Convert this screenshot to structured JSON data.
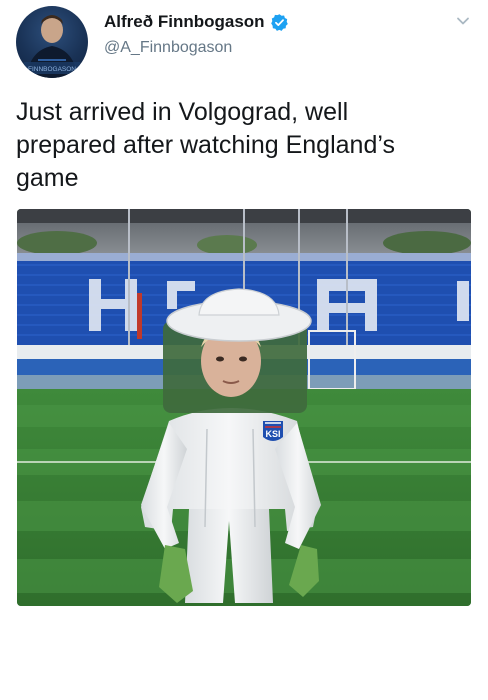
{
  "tweet": {
    "display_name": "Alfreð Finnbogason",
    "handle": "@A_Finnbogason",
    "text": "Just arrived in Volgograd, well\nprepared after watching England’s\ngame",
    "verified": true,
    "avatar_caption": "FINNBOGASON",
    "icons": {
      "verified": "verified-badge-icon",
      "menu": "chevron-down-icon"
    },
    "colors": {
      "verified_blue": "#1da1f2",
      "handle_gray": "#657786"
    }
  },
  "media": {
    "badge_text": "KSI"
  }
}
